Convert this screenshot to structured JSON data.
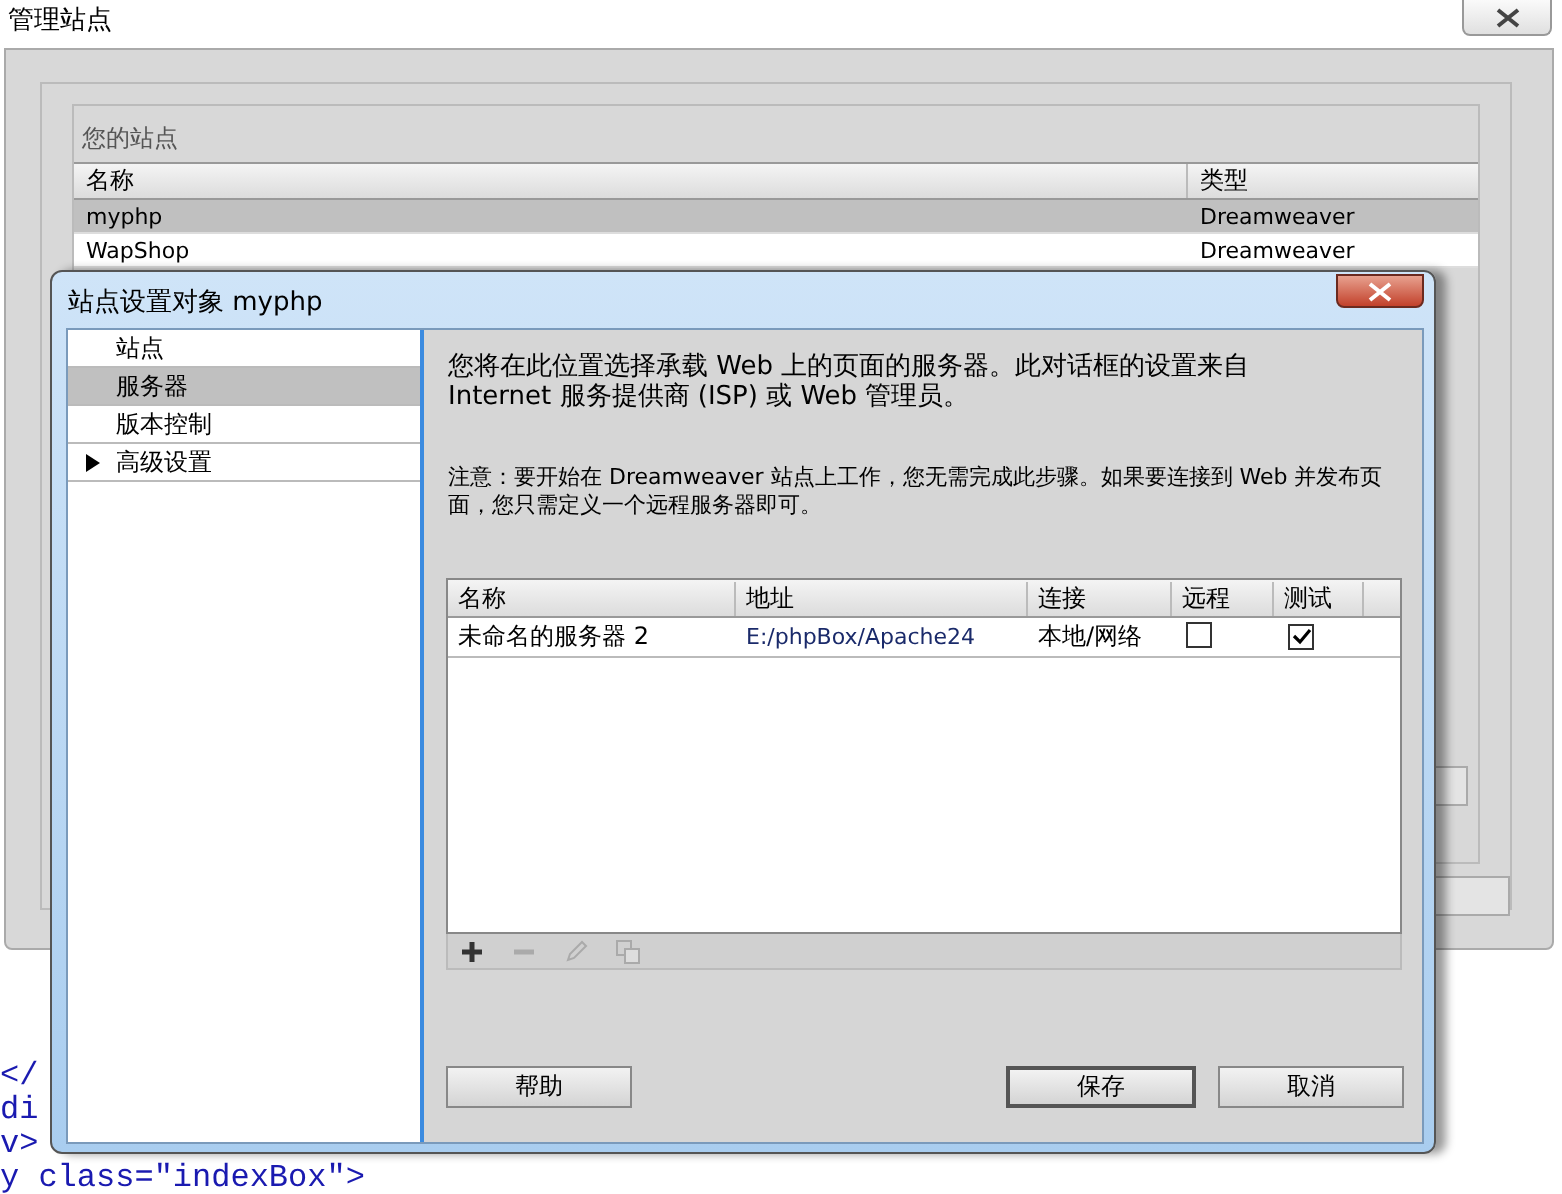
{
  "background_code": [
    "</",
    "di",
    "v>",
    "y class=\"indexBox\">"
  ],
  "manage_window": {
    "title": "管理站点",
    "group_title": "您的站点",
    "columns": [
      "名称",
      "类型"
    ],
    "sites": [
      {
        "name": "myphp",
        "type": "Dreamweaver",
        "selected": true
      },
      {
        "name": "WapShop",
        "type": "Dreamweaver",
        "selected": false
      }
    ]
  },
  "dialog": {
    "title": "站点设置对象 myphp",
    "nav": [
      {
        "label": "站点",
        "selected": false,
        "expandable": false
      },
      {
        "label": "服务器",
        "selected": true,
        "expandable": false
      },
      {
        "label": "版本控制",
        "selected": false,
        "expandable": false
      },
      {
        "label": "高级设置",
        "selected": false,
        "expandable": true
      }
    ],
    "intro": "您将在此位置选择承载 Web 上的页面的服务器。此对话框的设置来自 Internet 服务提供商 (ISP) 或 Web 管理员。",
    "note": "注意：要开始在 Dreamweaver 站点上工作，您无需完成此步骤。如果要连接到 Web 并发布页面，您只需定义一个远程服务器即可。",
    "server_table": {
      "columns": [
        "名称",
        "地址",
        "连接",
        "远程",
        "测试"
      ],
      "rows": [
        {
          "name": "未命名的服务器 2",
          "address": "E:/phpBox/Apache24",
          "connection": "本地/网络",
          "remote": false,
          "test": true
        }
      ]
    },
    "toolbar": [
      {
        "kind": "add",
        "disabled": false
      },
      {
        "kind": "remove",
        "disabled": true
      },
      {
        "kind": "edit",
        "disabled": true
      },
      {
        "kind": "duplicate",
        "disabled": true
      }
    ],
    "buttons": [
      {
        "label": "帮助",
        "default": false
      },
      {
        "label": "保存",
        "default": true
      },
      {
        "label": "取消",
        "default": false
      }
    ]
  }
}
